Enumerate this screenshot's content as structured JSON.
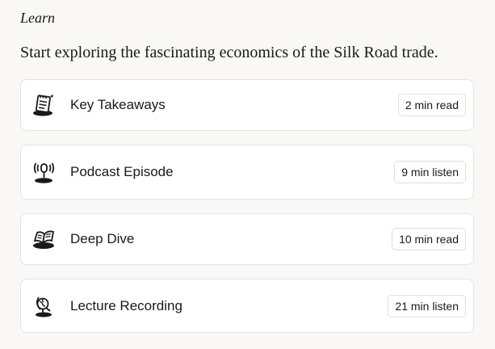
{
  "section_label": "Learn",
  "intro": "Start exploring the fascinating economics of the Silk Road trade.",
  "items": [
    {
      "icon": "notepad-icon",
      "title": "Key Takeaways",
      "duration": "2 min read"
    },
    {
      "icon": "podcast-icon",
      "title": "Podcast Episode",
      "duration": "9 min listen"
    },
    {
      "icon": "open-book-icon",
      "title": "Deep Dive",
      "duration": "10 min read"
    },
    {
      "icon": "lecture-globe-icon",
      "title": "Lecture Recording",
      "duration": "21 min listen"
    }
  ],
  "colors": {
    "background": "#f9f8f6",
    "card": "#ffffff",
    "border": "#e6e4e0",
    "text": "#1a1a1a"
  }
}
